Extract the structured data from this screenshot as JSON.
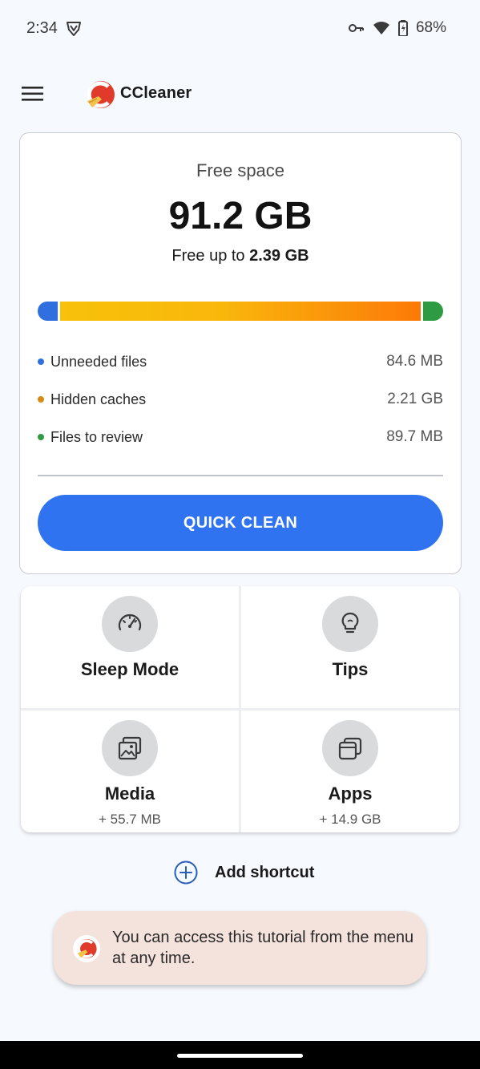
{
  "status_bar": {
    "time": "2:34",
    "battery": "68%"
  },
  "app_bar": {
    "brand": "CCleaner"
  },
  "storage": {
    "free_label": "Free space",
    "free_value": "91.2 GB",
    "free_up_prefix": "Free up to",
    "free_up_value": "2.39 GB",
    "items": [
      {
        "label": "Unneeded files",
        "value": "84.6 MB",
        "color": "#2f6fe0"
      },
      {
        "label": "Hidden caches",
        "value": "2.21 GB",
        "color": "#d98a14"
      },
      {
        "label": "Files to review",
        "value": "89.7 MB",
        "color": "#2e9b43"
      }
    ],
    "quick_clean_label": "QUICK CLEAN"
  },
  "tiles": [
    {
      "title": "Sleep Mode",
      "subtitle": "",
      "icon": "gauge-icon"
    },
    {
      "title": "Tips",
      "subtitle": "",
      "icon": "lightbulb-icon"
    },
    {
      "title": "Media",
      "subtitle": "+ 55.7 MB",
      "icon": "images-icon"
    },
    {
      "title": "Apps",
      "subtitle": "+ 14.9 GB",
      "icon": "stacked-windows-icon"
    }
  ],
  "add_shortcut_label": "Add shortcut",
  "toast": {
    "text": "You can access this tutorial from the menu at any time."
  },
  "colors": {
    "accent": "#2f73f0",
    "background": "#f6f9fd",
    "toast_bg": "#f4e2dc"
  }
}
